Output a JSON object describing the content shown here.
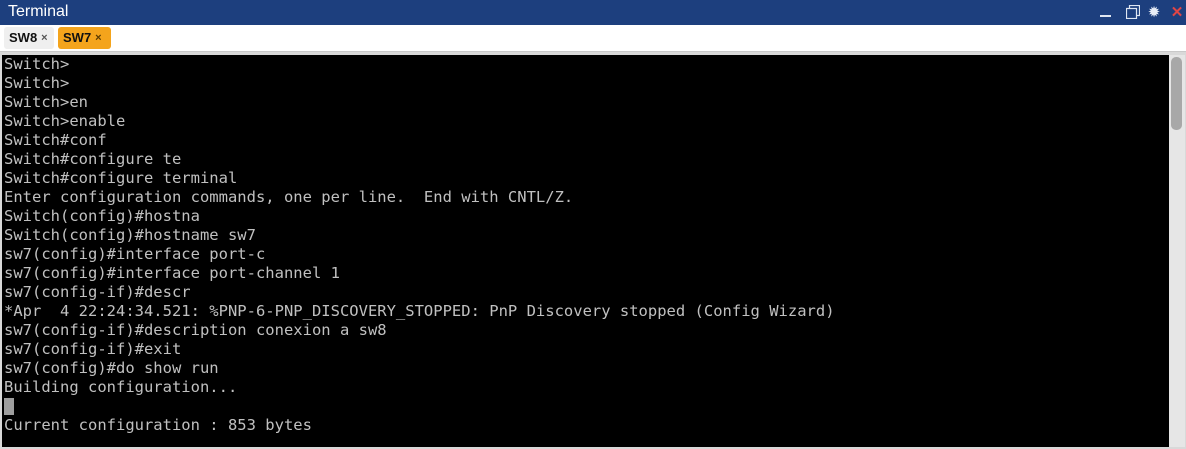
{
  "window": {
    "title": "Terminal",
    "controls": {
      "minimize_icon": "minimize-icon",
      "restore_icon": "restore-icon",
      "settings_icon": "gear-icon",
      "close_icon": "close-icon"
    },
    "colors": {
      "titlebar": "#1d3f7e",
      "active_tab": "#f4a41c",
      "close": "#e04646"
    }
  },
  "tabs": [
    {
      "label": "SW8",
      "close": "×",
      "active": false
    },
    {
      "label": "SW7",
      "close": "×",
      "active": true
    }
  ],
  "terminal": {
    "lines": [
      "Switch>",
      "Switch>",
      "Switch>en",
      "Switch>enable",
      "Switch#conf",
      "Switch#configure te",
      "Switch#configure terminal",
      "Enter configuration commands, one per line.  End with CNTL/Z.",
      "Switch(config)#hostna",
      "Switch(config)#hostname sw7",
      "sw7(config)#interface port-c",
      "sw7(config)#interface port-channel 1",
      "sw7(config-if)#descr",
      "*Apr  4 22:24:34.521: %PNP-6-PNP_DISCOVERY_STOPPED: PnP Discovery stopped (Config Wizard)",
      "sw7(config-if)#description conexion a sw8",
      "sw7(config-if)#exit",
      "sw7(config)#do show run",
      "Building configuration...",
      "",
      "Current configuration : 853 bytes"
    ],
    "colors": {
      "background": "#000000",
      "text": "#c0c0c0"
    }
  }
}
